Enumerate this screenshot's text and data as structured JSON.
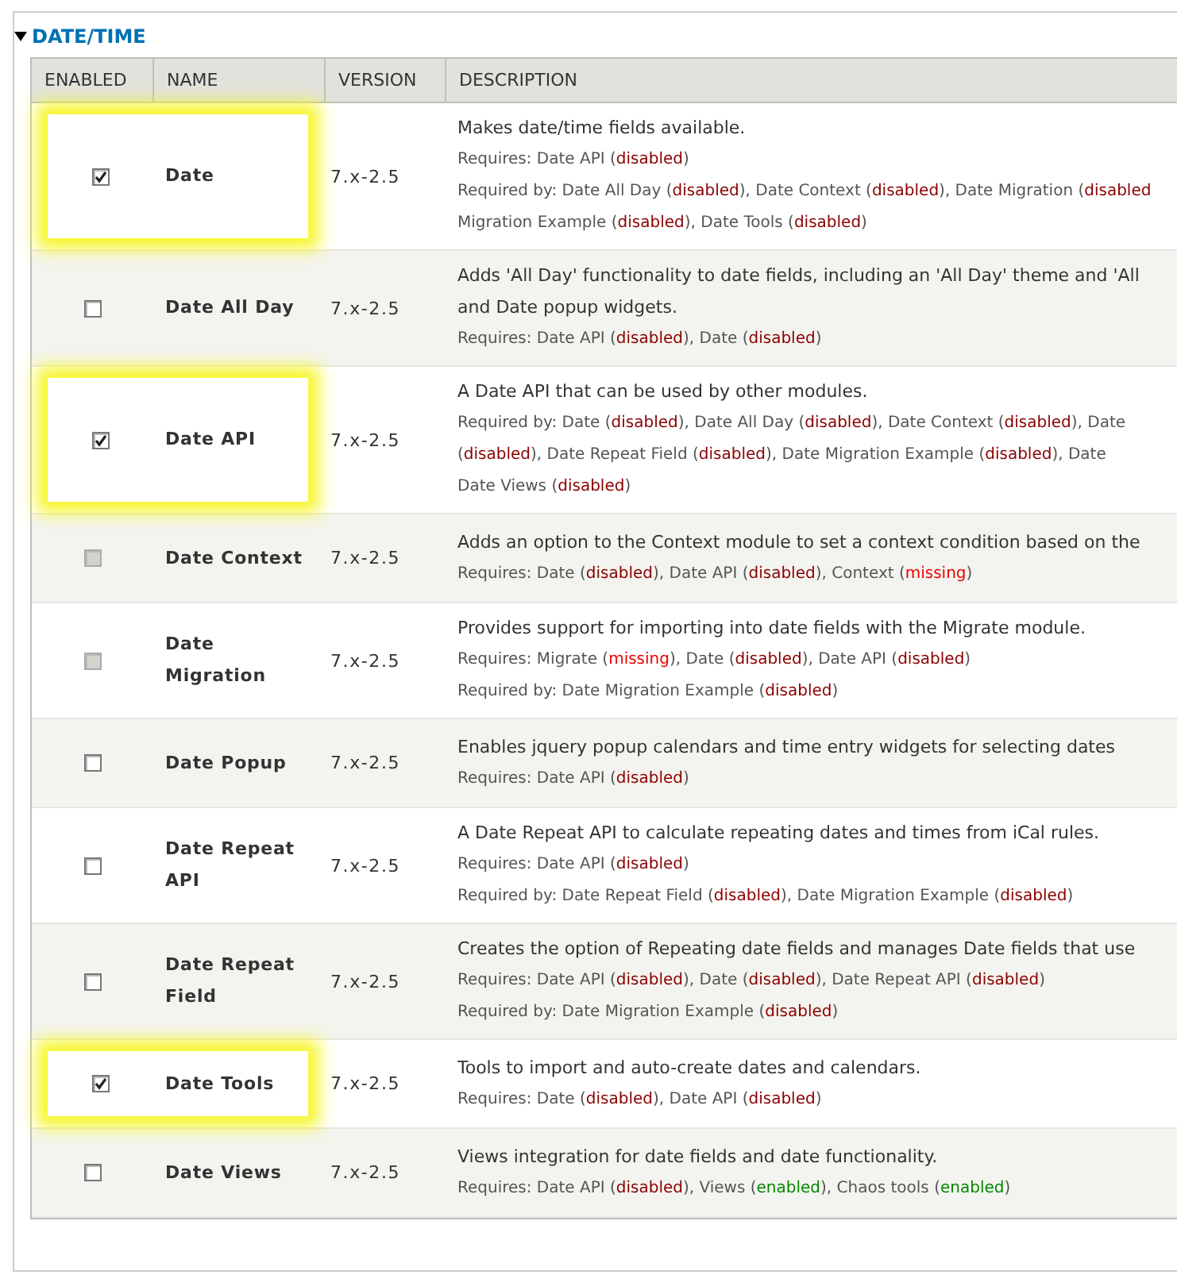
{
  "section": {
    "title": "DATE/TIME",
    "expanded": true
  },
  "columns": [
    "ENABLED",
    "NAME",
    "VERSION",
    "DESCRIPTION"
  ],
  "rows": [
    {
      "name": "Date",
      "version": "7.x-2.5",
      "enabled": true,
      "disabled": false,
      "highlighted": true,
      "description": "Makes date/time fields available.",
      "details": [
        [
          {
            "kind": "plain",
            "text": "Requires: Date API ("
          },
          {
            "kind": "disabled",
            "text": "disabled"
          },
          {
            "kind": "plain",
            "text": ")"
          }
        ],
        [
          {
            "kind": "plain",
            "text": "Required by: Date All Day ("
          },
          {
            "kind": "disabled",
            "text": "disabled"
          },
          {
            "kind": "plain",
            "text": "), Date Context ("
          },
          {
            "kind": "disabled",
            "text": "disabled"
          },
          {
            "kind": "plain",
            "text": "), Date Migration ("
          },
          {
            "kind": "disabled",
            "text": "disabled"
          }
        ],
        [
          {
            "kind": "plain",
            "text": "Migration Example ("
          },
          {
            "kind": "disabled",
            "text": "disabled"
          },
          {
            "kind": "plain",
            "text": "), Date Tools ("
          },
          {
            "kind": "disabled",
            "text": "disabled"
          },
          {
            "kind": "plain",
            "text": ")"
          }
        ]
      ]
    },
    {
      "name": "Date All Day",
      "version": "7.x-2.5",
      "enabled": false,
      "disabled": false,
      "highlighted": false,
      "description": "Adds 'All Day' functionality to date fields, including an 'All Day' theme and 'All",
      "description_2": "and Date popup widgets.",
      "details": [
        [
          {
            "kind": "plain",
            "text": "Requires: Date API ("
          },
          {
            "kind": "disabled",
            "text": "disabled"
          },
          {
            "kind": "plain",
            "text": "), Date ("
          },
          {
            "kind": "disabled",
            "text": "disabled"
          },
          {
            "kind": "plain",
            "text": ")"
          }
        ]
      ]
    },
    {
      "name": "Date API",
      "version": "7.x-2.5",
      "enabled": true,
      "disabled": false,
      "highlighted": true,
      "description": "A Date API that can be used by other modules.",
      "details": [
        [
          {
            "kind": "plain",
            "text": "Required by: Date ("
          },
          {
            "kind": "disabled",
            "text": "disabled"
          },
          {
            "kind": "plain",
            "text": "), Date All Day ("
          },
          {
            "kind": "disabled",
            "text": "disabled"
          },
          {
            "kind": "plain",
            "text": "), Date Context ("
          },
          {
            "kind": "disabled",
            "text": "disabled"
          },
          {
            "kind": "plain",
            "text": "), Date"
          }
        ],
        [
          {
            "kind": "plain",
            "text": "("
          },
          {
            "kind": "disabled",
            "text": "disabled"
          },
          {
            "kind": "plain",
            "text": "), Date Repeat Field ("
          },
          {
            "kind": "disabled",
            "text": "disabled"
          },
          {
            "kind": "plain",
            "text": "), Date Migration Example ("
          },
          {
            "kind": "disabled",
            "text": "disabled"
          },
          {
            "kind": "plain",
            "text": "), Date"
          }
        ],
        [
          {
            "kind": "plain",
            "text": "Date Views ("
          },
          {
            "kind": "disabled",
            "text": "disabled"
          },
          {
            "kind": "plain",
            "text": ")"
          }
        ]
      ]
    },
    {
      "name": "Date Context",
      "version": "7.x-2.5",
      "enabled": false,
      "disabled": true,
      "highlighted": false,
      "description": "Adds an option to the Context module to set a context condition based on the",
      "details": [
        [
          {
            "kind": "plain",
            "text": "Requires: Date ("
          },
          {
            "kind": "disabled",
            "text": "disabled"
          },
          {
            "kind": "plain",
            "text": "), Date API ("
          },
          {
            "kind": "disabled",
            "text": "disabled"
          },
          {
            "kind": "plain",
            "text": "), Context ("
          },
          {
            "kind": "missing",
            "text": "missing"
          },
          {
            "kind": "plain",
            "text": ")"
          }
        ]
      ]
    },
    {
      "name": "Date Migration",
      "version": "7.x-2.5",
      "enabled": false,
      "disabled": true,
      "highlighted": false,
      "description": "Provides support for importing into date fields with the Migrate module.",
      "details": [
        [
          {
            "kind": "plain",
            "text": "Requires: Migrate ("
          },
          {
            "kind": "missing",
            "text": "missing"
          },
          {
            "kind": "plain",
            "text": "), Date ("
          },
          {
            "kind": "disabled",
            "text": "disabled"
          },
          {
            "kind": "plain",
            "text": "), Date API ("
          },
          {
            "kind": "disabled",
            "text": "disabled"
          },
          {
            "kind": "plain",
            "text": ")"
          }
        ],
        [
          {
            "kind": "plain",
            "text": "Required by: Date Migration Example ("
          },
          {
            "kind": "disabled",
            "text": "disabled"
          },
          {
            "kind": "plain",
            "text": ")"
          }
        ]
      ]
    },
    {
      "name": "Date Popup",
      "version": "7.x-2.5",
      "enabled": false,
      "disabled": false,
      "highlighted": false,
      "description": "Enables jquery popup calendars and time entry widgets for selecting dates",
      "details": [
        [
          {
            "kind": "plain",
            "text": "Requires: Date API ("
          },
          {
            "kind": "disabled",
            "text": "disabled"
          },
          {
            "kind": "plain",
            "text": ")"
          }
        ]
      ]
    },
    {
      "name": "Date Repeat API",
      "version": "7.x-2.5",
      "enabled": false,
      "disabled": false,
      "highlighted": false,
      "description": "A Date Repeat API to calculate repeating dates and times from iCal rules.",
      "details": [
        [
          {
            "kind": "plain",
            "text": "Requires: Date API ("
          },
          {
            "kind": "disabled",
            "text": "disabled"
          },
          {
            "kind": "plain",
            "text": ")"
          }
        ],
        [
          {
            "kind": "plain",
            "text": "Required by: Date Repeat Field ("
          },
          {
            "kind": "disabled",
            "text": "disabled"
          },
          {
            "kind": "plain",
            "text": "), Date Migration Example ("
          },
          {
            "kind": "disabled",
            "text": "disabled"
          },
          {
            "kind": "plain",
            "text": ")"
          }
        ]
      ]
    },
    {
      "name": "Date Repeat Field",
      "version": "7.x-2.5",
      "enabled": false,
      "disabled": false,
      "highlighted": false,
      "description": "Creates the option of Repeating date fields and manages Date fields that use",
      "details": [
        [
          {
            "kind": "plain",
            "text": "Requires: Date API ("
          },
          {
            "kind": "disabled",
            "text": "disabled"
          },
          {
            "kind": "plain",
            "text": "), Date ("
          },
          {
            "kind": "disabled",
            "text": "disabled"
          },
          {
            "kind": "plain",
            "text": "), Date Repeat API ("
          },
          {
            "kind": "disabled",
            "text": "disabled"
          },
          {
            "kind": "plain",
            "text": ")"
          }
        ],
        [
          {
            "kind": "plain",
            "text": "Required by: Date Migration Example ("
          },
          {
            "kind": "disabled",
            "text": "disabled"
          },
          {
            "kind": "plain",
            "text": ")"
          }
        ]
      ]
    },
    {
      "name": "Date Tools",
      "version": "7.x-2.5",
      "enabled": true,
      "disabled": false,
      "highlighted": true,
      "description": "Tools to import and auto-create dates and calendars.",
      "details": [
        [
          {
            "kind": "plain",
            "text": "Requires: Date ("
          },
          {
            "kind": "disabled",
            "text": "disabled"
          },
          {
            "kind": "plain",
            "text": "), Date API ("
          },
          {
            "kind": "disabled",
            "text": "disabled"
          },
          {
            "kind": "plain",
            "text": ")"
          }
        ]
      ]
    },
    {
      "name": "Date Views",
      "version": "7.x-2.5",
      "enabled": false,
      "disabled": false,
      "highlighted": false,
      "description": "Views integration for date fields and date functionality.",
      "details": [
        [
          {
            "kind": "plain",
            "text": "Requires: Date API ("
          },
          {
            "kind": "disabled",
            "text": "disabled"
          },
          {
            "kind": "plain",
            "text": "), Views ("
          },
          {
            "kind": "enabled",
            "text": "enabled"
          },
          {
            "kind": "plain",
            "text": "), Chaos tools ("
          },
          {
            "kind": "enabled",
            "text": "enabled"
          },
          {
            "kind": "plain",
            "text": ")"
          }
        ]
      ]
    }
  ]
}
